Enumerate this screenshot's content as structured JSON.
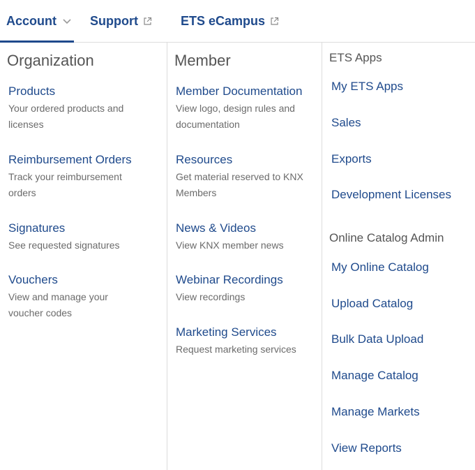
{
  "topnav": {
    "account_label": "Account",
    "support_label": "Support",
    "ecampus_label": "ETS eCampus"
  },
  "organization": {
    "heading": "Organization",
    "items": [
      {
        "title": "Products",
        "desc": "Your ordered products and licenses"
      },
      {
        "title": "Reimbursement Orders",
        "desc": "Track your reimbursement orders"
      },
      {
        "title": "Signatures",
        "desc": "See requested signatures"
      },
      {
        "title": "Vouchers",
        "desc": "View and manage your voucher codes"
      }
    ]
  },
  "member": {
    "heading": "Member",
    "items": [
      {
        "title": "Member Documentation",
        "desc": "View logo, design rules and documentation"
      },
      {
        "title": "Resources",
        "desc": "Get material reserved to KNX Members"
      },
      {
        "title": "News & Videos",
        "desc": "View KNX member news"
      },
      {
        "title": "Webinar Recordings",
        "desc": "View recordings"
      },
      {
        "title": "Marketing Services",
        "desc": "Request marketing services"
      }
    ]
  },
  "ets_apps": {
    "heading": "ETS Apps",
    "links": [
      "My ETS Apps",
      "Sales",
      "Exports",
      "Development Licenses"
    ]
  },
  "catalog_admin": {
    "heading": "Online Catalog Admin",
    "links": [
      "My Online Catalog",
      "Upload Catalog",
      "Bulk Data Upload",
      "Manage Catalog",
      "Manage Markets",
      "View Reports"
    ]
  },
  "colors": {
    "link": "#1f4a8c",
    "heading": "#555555",
    "desc": "#6b6b6b",
    "divider": "#dcdcdc"
  },
  "icons": {
    "account_toggle": "chevron-down-icon",
    "external": "external-link-icon"
  }
}
